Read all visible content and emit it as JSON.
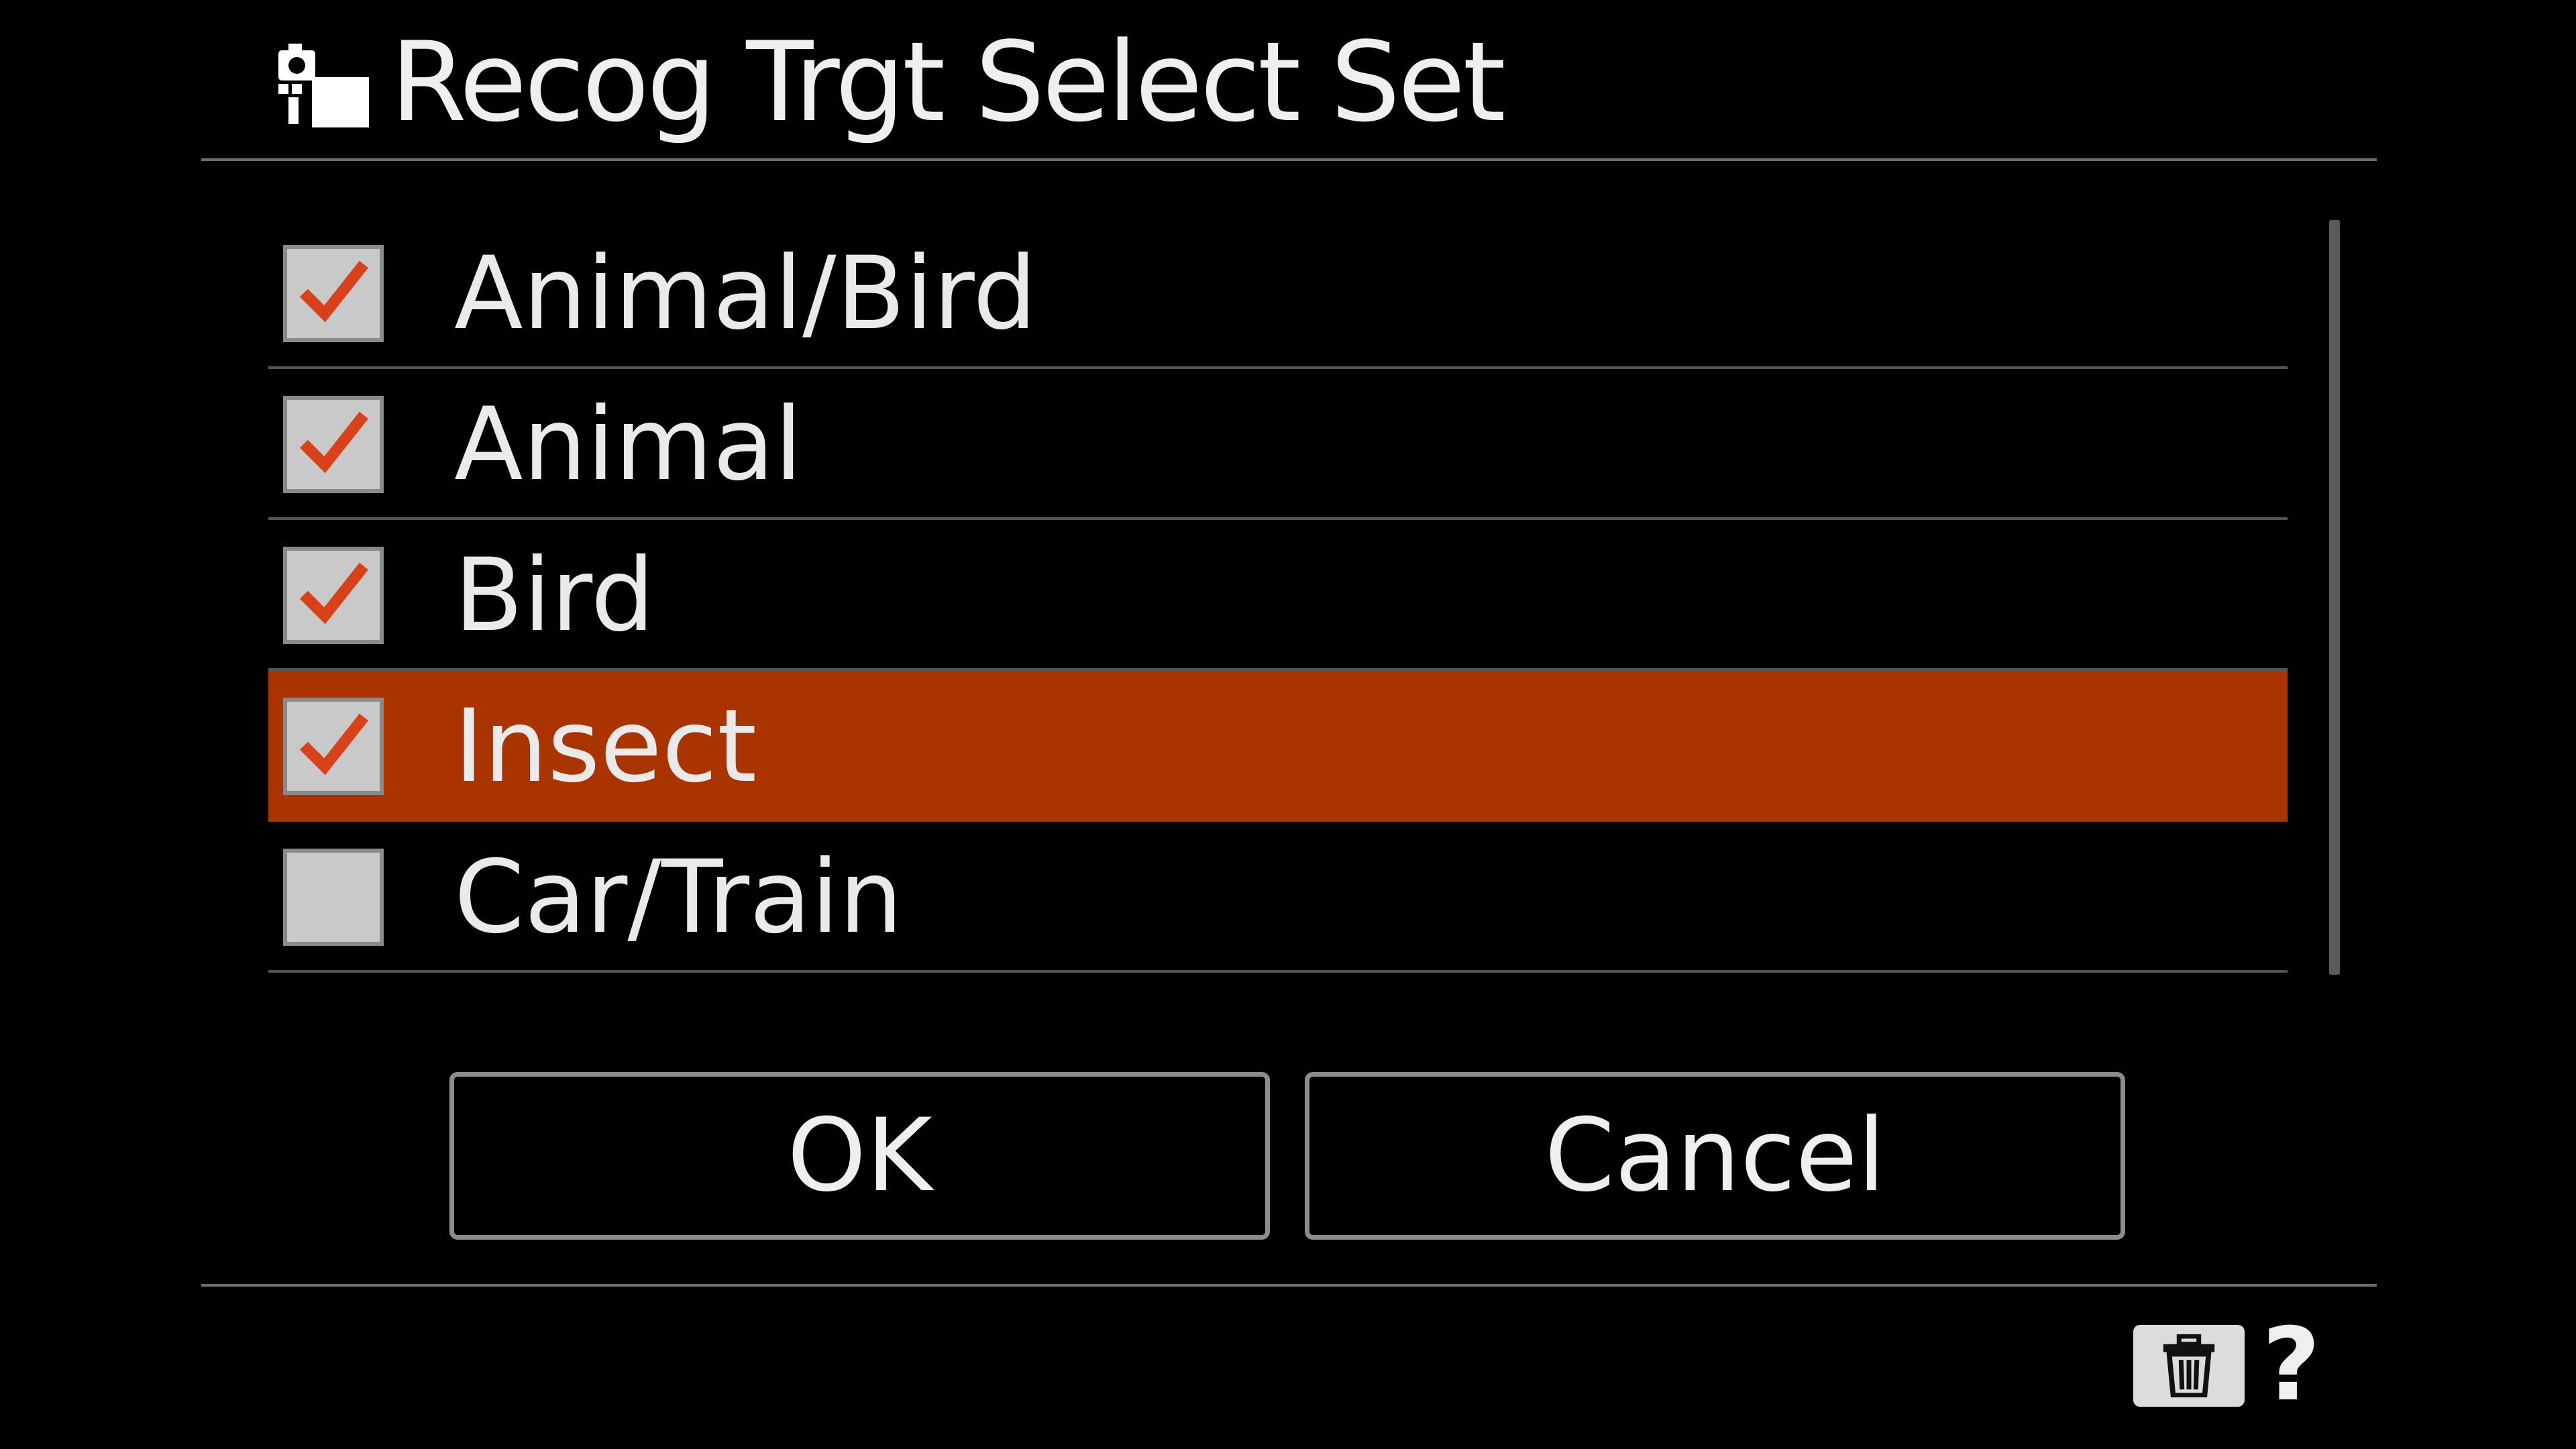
{
  "screen": {
    "title": "Recog Trgt Select Set",
    "title_icon": "camera-focus-target-icon"
  },
  "items": [
    {
      "label": "Animal/Bird",
      "checked": true,
      "selected": false
    },
    {
      "label": "Animal",
      "checked": true,
      "selected": false
    },
    {
      "label": "Bird",
      "checked": true,
      "selected": false
    },
    {
      "label": "Insect",
      "checked": true,
      "selected": true
    },
    {
      "label": "Car/Train",
      "checked": false,
      "selected": false
    }
  ],
  "buttons": {
    "ok_label": "OK",
    "cancel_label": "Cancel"
  },
  "footer": {
    "delete_icon": "trash-icon",
    "help_label": "?"
  },
  "colors": {
    "background": "#000000",
    "highlight": "#a93400",
    "checkmark": "#d8421a",
    "checkbox_fill": "#c9c9c9"
  }
}
